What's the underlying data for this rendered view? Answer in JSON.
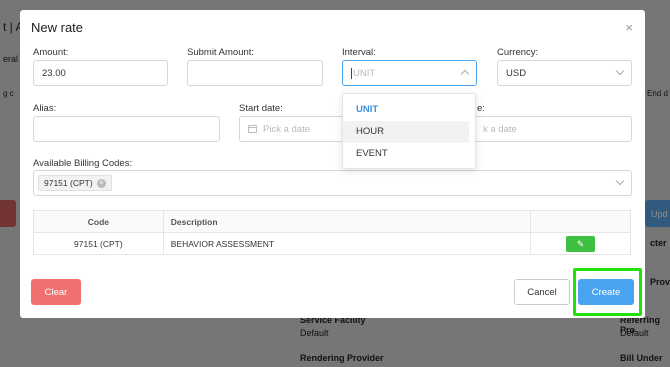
{
  "background": {
    "left_texts": [
      "t | A",
      "eral",
      "g c"
    ],
    "right_texts": [
      "End d"
    ],
    "lower_right_labels": [
      "cter",
      "Provi",
      "Referring Pro",
      "Default",
      "Bill Under"
    ],
    "lower_left_labels": [
      "Service Facility",
      "Default",
      "Rendering Provider"
    ],
    "update_label": "Upd"
  },
  "modal": {
    "title": "New rate",
    "close_glyph": "×",
    "amount": {
      "label": "Amount:",
      "value": "23.00"
    },
    "submit_amount": {
      "label": "Submit Amount:",
      "value": ""
    },
    "interval": {
      "label": "Interval:",
      "placeholder": "UNIT",
      "options": [
        "UNIT",
        "HOUR",
        "EVENT"
      ],
      "selected": "UNIT",
      "hovered": "HOUR"
    },
    "currency": {
      "label": "Currency:",
      "value": "USD"
    },
    "alias": {
      "label": "Alias:",
      "value": ""
    },
    "start_date": {
      "label": "Start date:",
      "placeholder": "Pick a date"
    },
    "end_date": {
      "label": "e:",
      "placeholder": "k a date"
    },
    "billing_codes": {
      "label": "Available Billing Codes:",
      "tag": "97151 (CPT)"
    },
    "table": {
      "headers": [
        "Code",
        "Description",
        ""
      ],
      "rows": [
        {
          "code": "97151 (CPT)",
          "description": "BEHAVIOR ASSESSMENT",
          "action_icon": "edit-icon"
        }
      ]
    },
    "buttons": {
      "clear": "Clear",
      "cancel": "Cancel",
      "create": "Create"
    }
  },
  "colors": {
    "primary": "#4aa3f0",
    "danger": "#f07070",
    "success": "#3fbf3f",
    "highlight": "#22e010"
  }
}
